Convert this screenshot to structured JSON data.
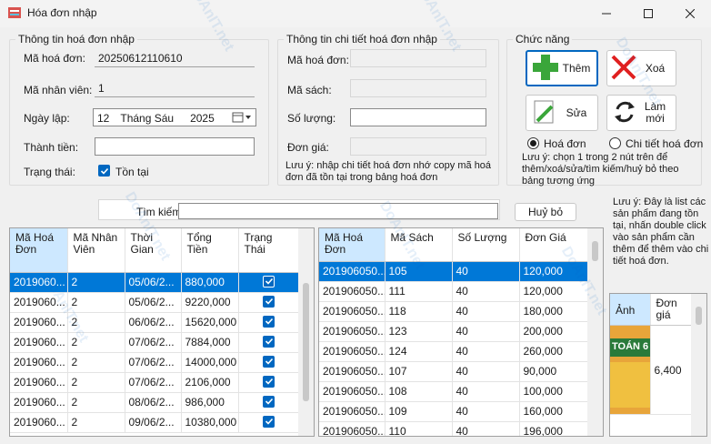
{
  "window": {
    "title": "Hóa đơn nhập"
  },
  "invoice_info": {
    "group_title": "Thông tin hoá đơn nhập",
    "invoice_id_label": "Mã hoá đơn:",
    "invoice_id_value": "20250612110610",
    "employee_id_label": "Mã nhân viên:",
    "employee_id_value": "1",
    "date_label": "Ngày lập:",
    "date_day": "12",
    "date_month": "Tháng Sáu",
    "date_year": "2025",
    "total_label": "Thành tiền:",
    "total_value": "",
    "status_label": "Trạng thái:",
    "status_checkbox_label": "Tồn tại",
    "status_checked": true
  },
  "detail_info": {
    "group_title": "Thông tin chi tiết hoá đơn nhập",
    "invoice_id_label": "Mã hoá đơn:",
    "book_id_label": "Mã sách:",
    "quantity_label": "Số lượng:",
    "unit_price_label": "Đơn giá:",
    "note": "Lưu ý: nhập chi tiết hoá đơn nhớ copy mã hoá đơn đã tồn tại trong bảng hoá đơn"
  },
  "functions": {
    "group_title": "Chức năng",
    "add_label": "Thêm",
    "delete_label": "Xoá",
    "edit_label": "Sửa",
    "refresh_label": "Làm mới",
    "radio_invoice_label": "Hoá đơn",
    "radio_detail_label": "Chi tiết hoá đơn",
    "radio_selected": "invoice",
    "note": "Lưu ý: chọn 1 trong 2 nút trên để thêm/xoá/sửa/tìm kiếm/huỷ bỏ theo bảng tương ứng"
  },
  "search": {
    "label": "Tìm kiếm:",
    "value": "",
    "cancel_label": "Huỷ bỏ"
  },
  "side_note": "Lưu ý: Đây là list các sản phẩm đang tồn tại, nhấn double click vào sản phẩm cần thêm để thêm vào chi tiết hoá đơn.",
  "invoice_table": {
    "headers": [
      "Mã Hoá Đơn",
      "Mã Nhân Viên",
      "Thời Gian",
      "Tổng Tiền",
      "Trạng Thái"
    ],
    "rows": [
      [
        "2019060...",
        "2",
        "05/06/2...",
        "880,000",
        true
      ],
      [
        "2019060...",
        "2",
        "05/06/2...",
        "9220,000",
        true
      ],
      [
        "2019060...",
        "2",
        "06/06/2...",
        "15620,000",
        true
      ],
      [
        "2019060...",
        "2",
        "07/06/2...",
        "7884,000",
        true
      ],
      [
        "2019060...",
        "2",
        "07/06/2...",
        "14000,000",
        true
      ],
      [
        "2019060...",
        "2",
        "07/06/2...",
        "2106,000",
        true
      ],
      [
        "2019060...",
        "2",
        "08/06/2...",
        "986,000",
        true
      ],
      [
        "2019060...",
        "2",
        "09/06/2...",
        "10380,000",
        true
      ]
    ]
  },
  "detail_table": {
    "headers": [
      "Mã Hoá Đơn",
      "Mã Sách",
      "Số Lượng",
      "Đơn Giá"
    ],
    "rows": [
      [
        "201906050...",
        "105",
        "40",
        "120,000"
      ],
      [
        "201906050...",
        "111",
        "40",
        "120,000"
      ],
      [
        "201906050...",
        "118",
        "40",
        "180,000"
      ],
      [
        "201906050...",
        "123",
        "40",
        "200,000"
      ],
      [
        "201906050...",
        "124",
        "40",
        "260,000"
      ],
      [
        "201906050...",
        "107",
        "40",
        "90,000"
      ],
      [
        "201906050...",
        "108",
        "40",
        "100,000"
      ],
      [
        "201906050...",
        "109",
        "40",
        "160,000"
      ],
      [
        "201906050...",
        "110",
        "40",
        "196,000"
      ]
    ]
  },
  "product_table": {
    "headers": [
      "Ảnh",
      "Đơn giá"
    ],
    "rows": [
      [
        "TOÁN 6",
        "6,400"
      ]
    ]
  },
  "watermark": "DoAnIT.net",
  "colors": {
    "selection": "#0078d7",
    "checkbox": "#0067c0",
    "header_selected": "#cde8ff"
  }
}
